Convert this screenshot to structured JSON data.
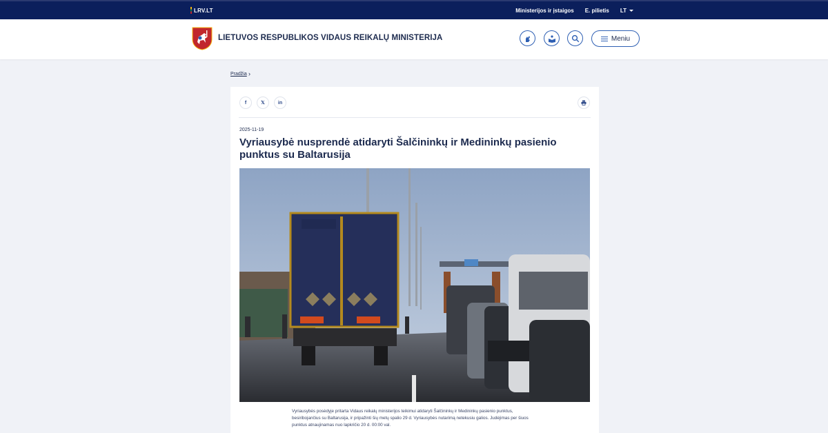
{
  "topbar": {
    "portal_label": "LRV.LT",
    "links": [
      "Ministerijos ir įstaigos",
      "E. pilietis"
    ],
    "language": "LT"
  },
  "header": {
    "site_name": "LIETUVOS RESPUBLIKOS VIDAUS REIKALŲ MINISTERIJA",
    "menu_label": "Meniu"
  },
  "breadcrumb": {
    "home": "Pradžia",
    "separator": "›"
  },
  "article": {
    "date": "2025-11-19",
    "title": "Vyriausybė nusprendė atidaryti Šalčininkų ir Medininkų pasienio punktus su Baltarusija",
    "lead": "Vyriausybės posėdyje pritarta Vidaus reikalų ministerijos teikimui atidaryti Šalčininkų ir Medininkų pasienio punktus, besiribojančius su Baltarusija, ir pripažinti šių metų spalio 29 d. Vyriausybės nutarimą netekusiu galios. Judėjimas per šiuos punktus atnaujinamas nuo lapkričio 20 d. 00:00 val.",
    "share": {
      "facebook": "f",
      "x": "𝕏",
      "linkedin": "in"
    }
  },
  "colors": {
    "topbar": "#0b1f5c",
    "accent": "#2e5fb3",
    "text": "#1c2a4e",
    "page_bg": "#f0f2f7"
  }
}
